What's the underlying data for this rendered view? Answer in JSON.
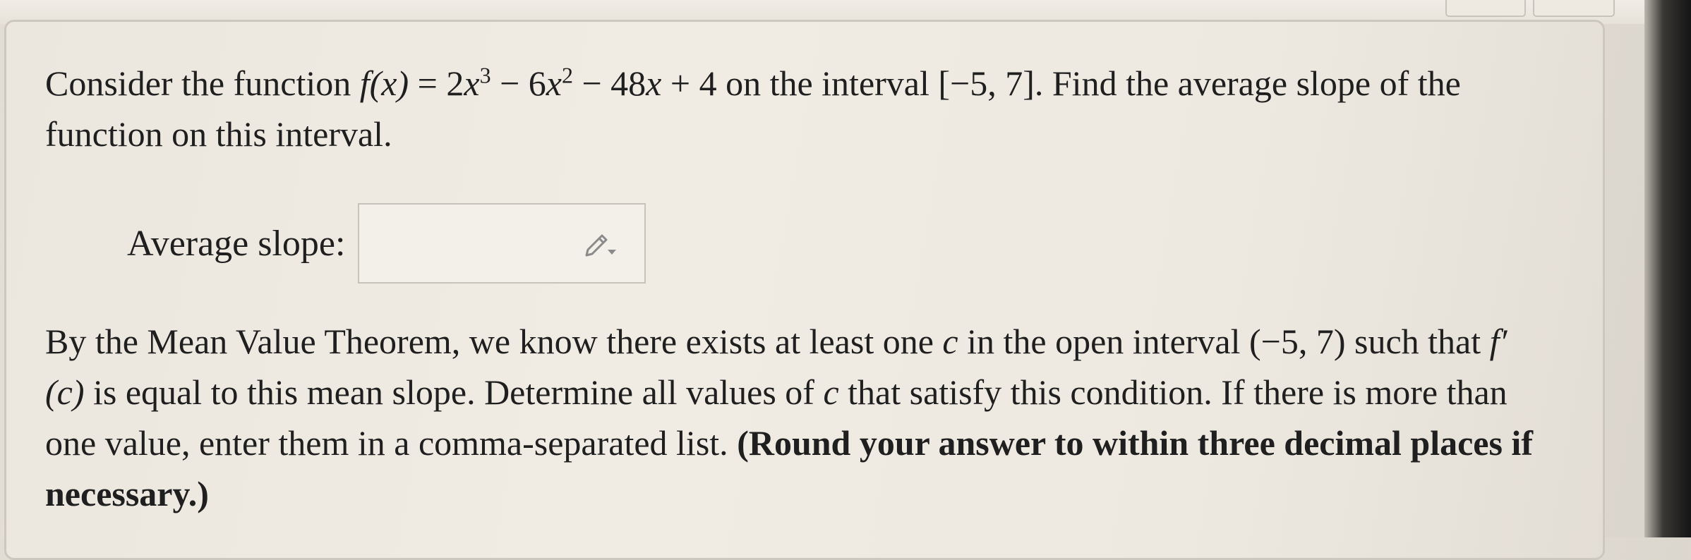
{
  "question": {
    "p1_prefix": "Consider the function ",
    "p1_fx": "f(x)",
    "p1_eq": " = 2",
    "p1_x1": "x",
    "p1_e1": "3",
    "p1_mid1": " − 6",
    "p1_x2": "x",
    "p1_e2": "2",
    "p1_mid2": " − 48",
    "p1_x3": "x",
    "p1_tail": " + 4 on the interval [−5, 7]. Find the average slope of the function on this interval."
  },
  "answer": {
    "label": "Average slope:",
    "value": "",
    "icon": "pencil-icon"
  },
  "mvt": {
    "s1": "By the Mean Value Theorem, we know there exists at least one ",
    "c1": "c",
    "s2": " in the open interval (−5, 7) such that ",
    "fprime": "f′(c)",
    "s3": " is equal to this mean slope. Determine all values of ",
    "c2": "c",
    "s4": " that satisfy this condition. If there is more than one value, enter them in a comma-separated list. ",
    "bold": "(Round your answer to within three decimal places if necessary.)"
  },
  "colors": {
    "text": "#1f1f1f",
    "card_border": "#cdc8bf",
    "icon": "#8a8a8a"
  }
}
